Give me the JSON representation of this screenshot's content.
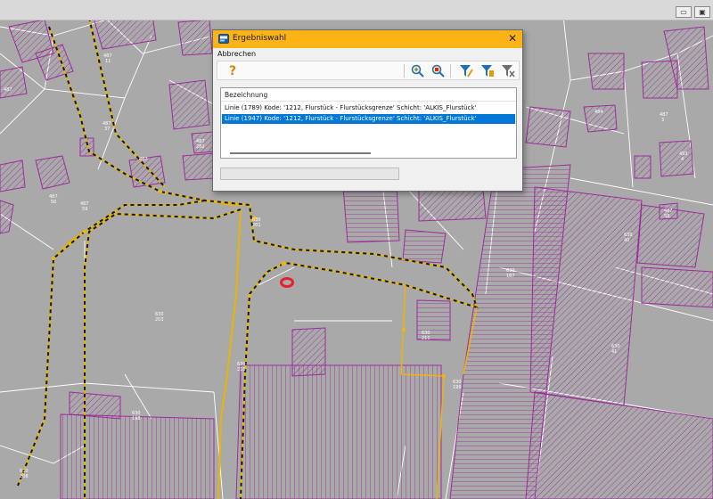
{
  "dialog": {
    "title": "Ergebniswahl",
    "close_glyph": "✕",
    "menu": {
      "cancel": "Abbrechen"
    },
    "toolbar": {
      "help_glyph": "?",
      "icons": [
        "help-icon",
        "zoom-in-icon",
        "zoom-to-icon",
        "filter-icon",
        "filter-advanced-icon",
        "filter-remove-icon"
      ]
    },
    "list": {
      "column": "Bezeichnung",
      "rows": [
        {
          "text": "Linie (1789) Kode: '1212, Flurstück - Flurstücksgrenze' Schicht: 'ALKIS_Flurstück'",
          "selected": false
        },
        {
          "text": "Linie (1947) Kode: '1212, Flurstück - Flurstücksgrenze' Schicht: 'ALKIS_Flurstück'",
          "selected": true
        }
      ]
    }
  },
  "window_controls": {
    "minimize": "▭",
    "restore": "▣"
  },
  "map": {
    "colors": {
      "background": "#a9a9a9",
      "building": "#9b2d9b",
      "boundary": "#e8b600",
      "line": "#ffffff",
      "marker": "#e5202a",
      "selection": "#0078d7"
    },
    "labels": [
      "487 11",
      "487 37",
      "487 50",
      "487 58",
      "487 59",
      "487 46",
      "630 203",
      "630 201",
      "630 210",
      "630 199",
      "630 185",
      "630 211",
      "630 207",
      "630 197",
      "630 40",
      "487 58",
      "493 4",
      "487 3",
      "630 210"
    ]
  }
}
